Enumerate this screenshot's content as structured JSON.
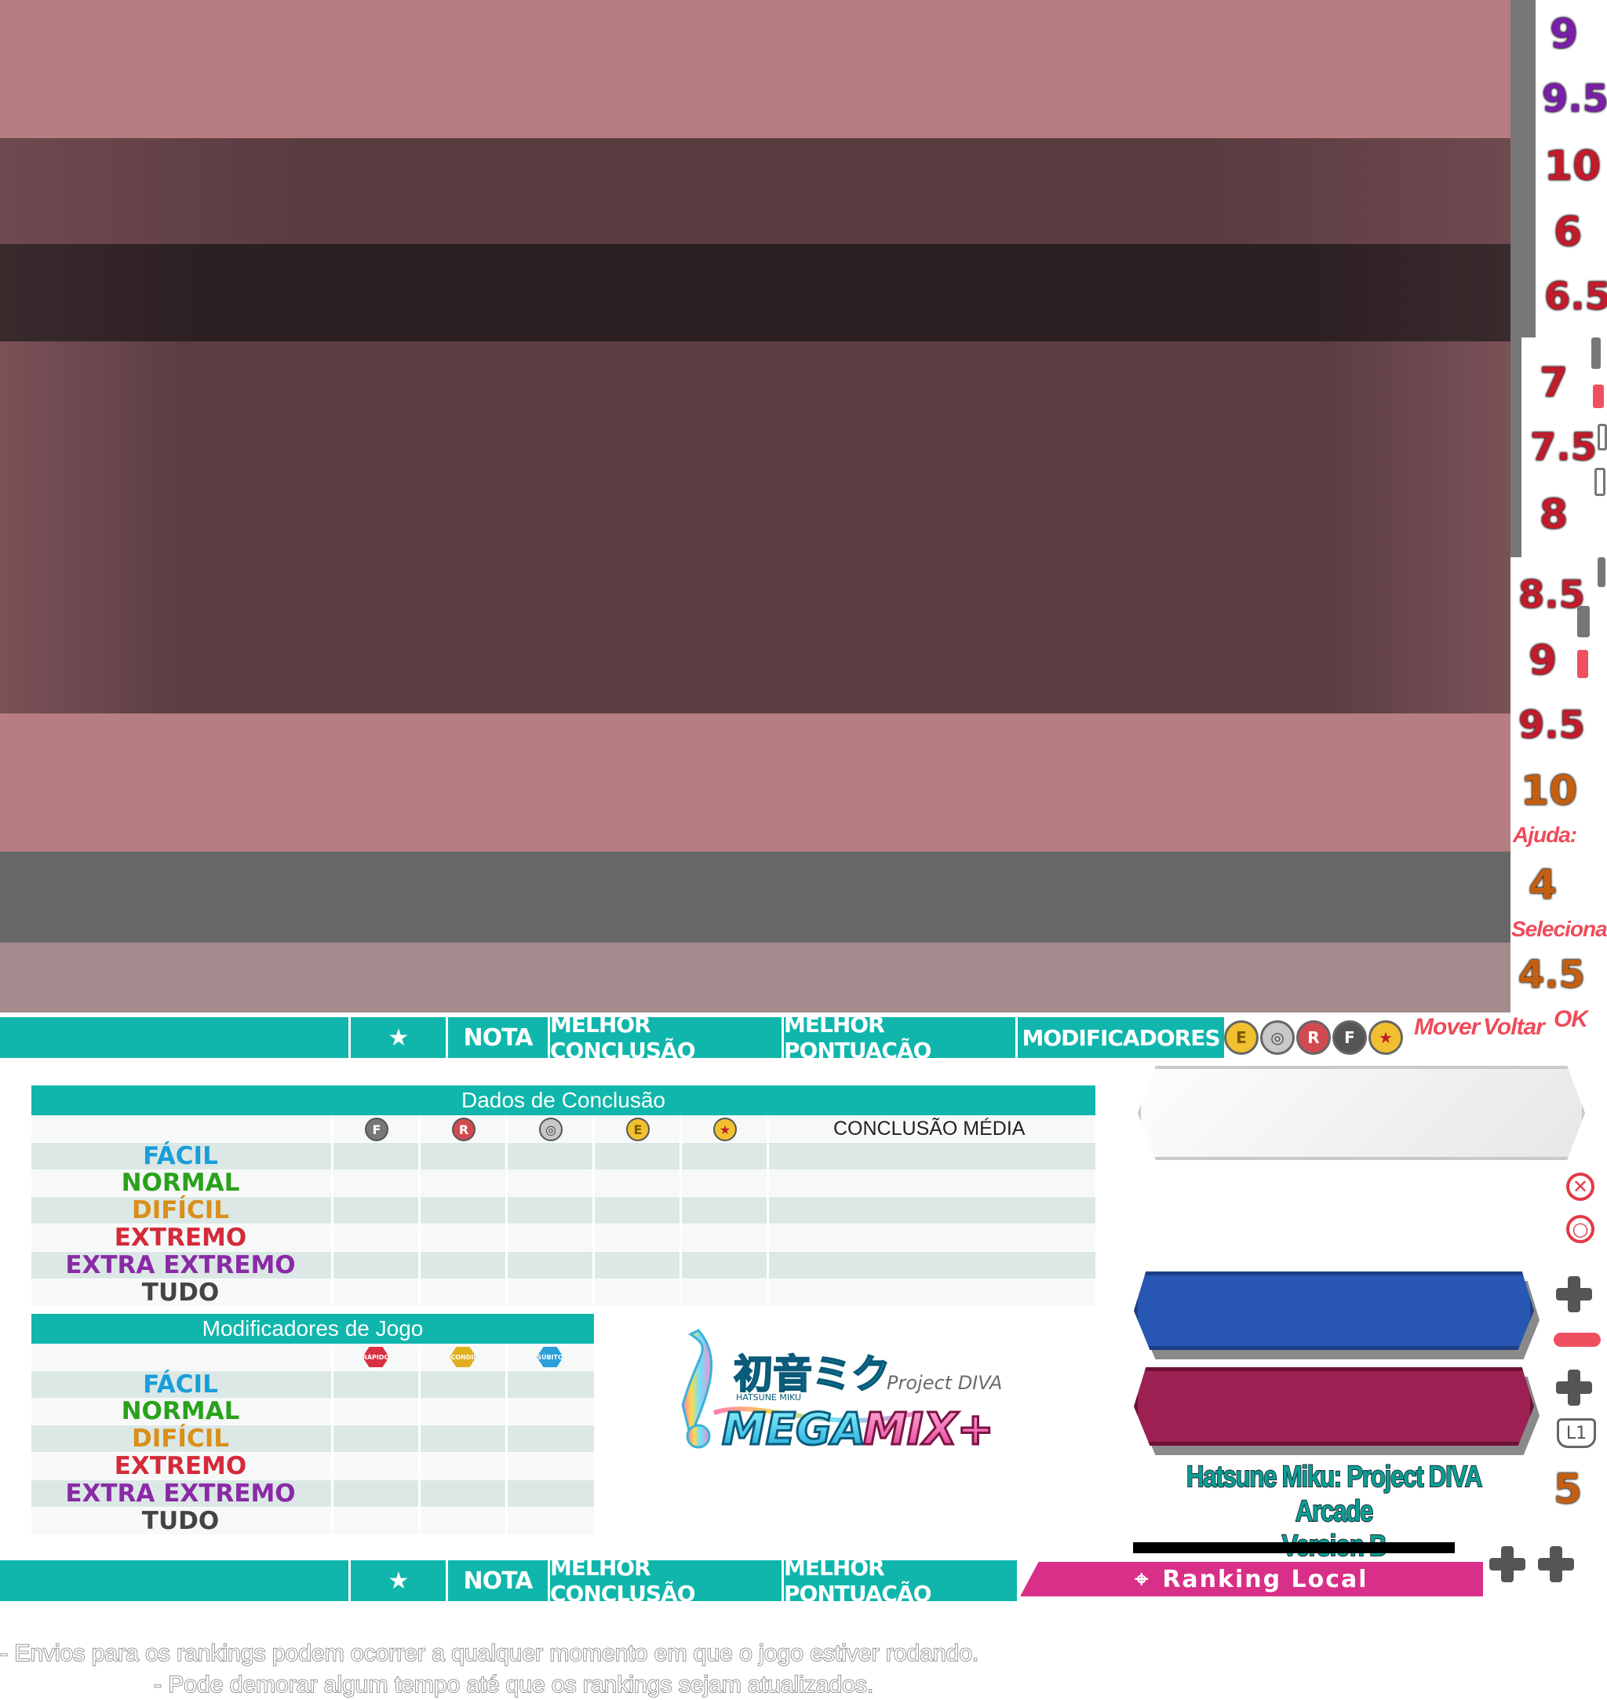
{
  "difficulty_numbers": [
    {
      "label": "9",
      "color": "purple"
    },
    {
      "label": "9.5",
      "color": "purple"
    },
    {
      "label": "10",
      "color": "red"
    },
    {
      "label": "6",
      "color": "red"
    },
    {
      "label": "6.5",
      "color": "red"
    },
    {
      "label": "7",
      "color": "red"
    },
    {
      "label": "7.5",
      "color": "red"
    },
    {
      "label": "8",
      "color": "red"
    },
    {
      "label": "8.5",
      "color": "red"
    },
    {
      "label": "9",
      "color": "red"
    },
    {
      "label": "9.5",
      "color": "red"
    },
    {
      "label": "10",
      "color": "orange"
    },
    {
      "label": "4",
      "color": "orange"
    },
    {
      "label": "4.5",
      "color": "orange"
    },
    {
      "label": "5",
      "color": "orange"
    }
  ],
  "labels": {
    "ajuda": "Ajuda:",
    "selecionar": "Selecionar",
    "mover": "Mover",
    "voltar": "Voltar",
    "ok": "OK"
  },
  "header_tabs": {
    "star": "★",
    "nota": "NOTA",
    "melhor_conclusao": "MELHOR CONCLUSÃO",
    "melhor_pontuacao": "MELHOR PONTUAÇÃO",
    "modificadores": "MODIFICADORES"
  },
  "clear_icons": [
    "E",
    "◎",
    "R",
    "F",
    "★"
  ],
  "clear_table": {
    "title": "Dados de Conclusão",
    "columns": [
      "F",
      "R",
      "◎",
      "E",
      "★"
    ],
    "average_label": "CONCLUSÃO MÉDIA",
    "rows": [
      "FÁCIL",
      "NORMAL",
      "DIFÍCIL",
      "EXTREMO",
      "EXTRA EXTREMO",
      "TUDO"
    ]
  },
  "mod_table": {
    "title": "Modificadores de Jogo",
    "columns": [
      "RÁPIDO",
      "ESCONDIDO",
      "SÚBITO"
    ],
    "rows": [
      "FÁCIL",
      "NORMAL",
      "DIFÍCIL",
      "EXTREMO",
      "EXTRA EXTREMO",
      "TUDO"
    ]
  },
  "logo": {
    "line1": "初音ミク",
    "sub": "HATSUNE MIKU",
    "project": "Project DIVA",
    "mega": "MEGA",
    "mix": "MIX+"
  },
  "game_title": {
    "line1": "Hatsune Miku: Project DIVA Arcade",
    "line2": "Version B"
  },
  "button_l1": "L1",
  "ranking": "Ranking Local",
  "footer": {
    "line1": "- Envios para os rankings podem ocorrer a qualquer momento em que o jogo estiver rodando.",
    "line2": "- Pode demorar algum tempo até que os rankings sejam atualizados."
  },
  "colors": {
    "teal": "#10b6ac",
    "pink": "#d83088",
    "blue_panel": "#2857b3",
    "pink_panel": "#9c2152"
  }
}
